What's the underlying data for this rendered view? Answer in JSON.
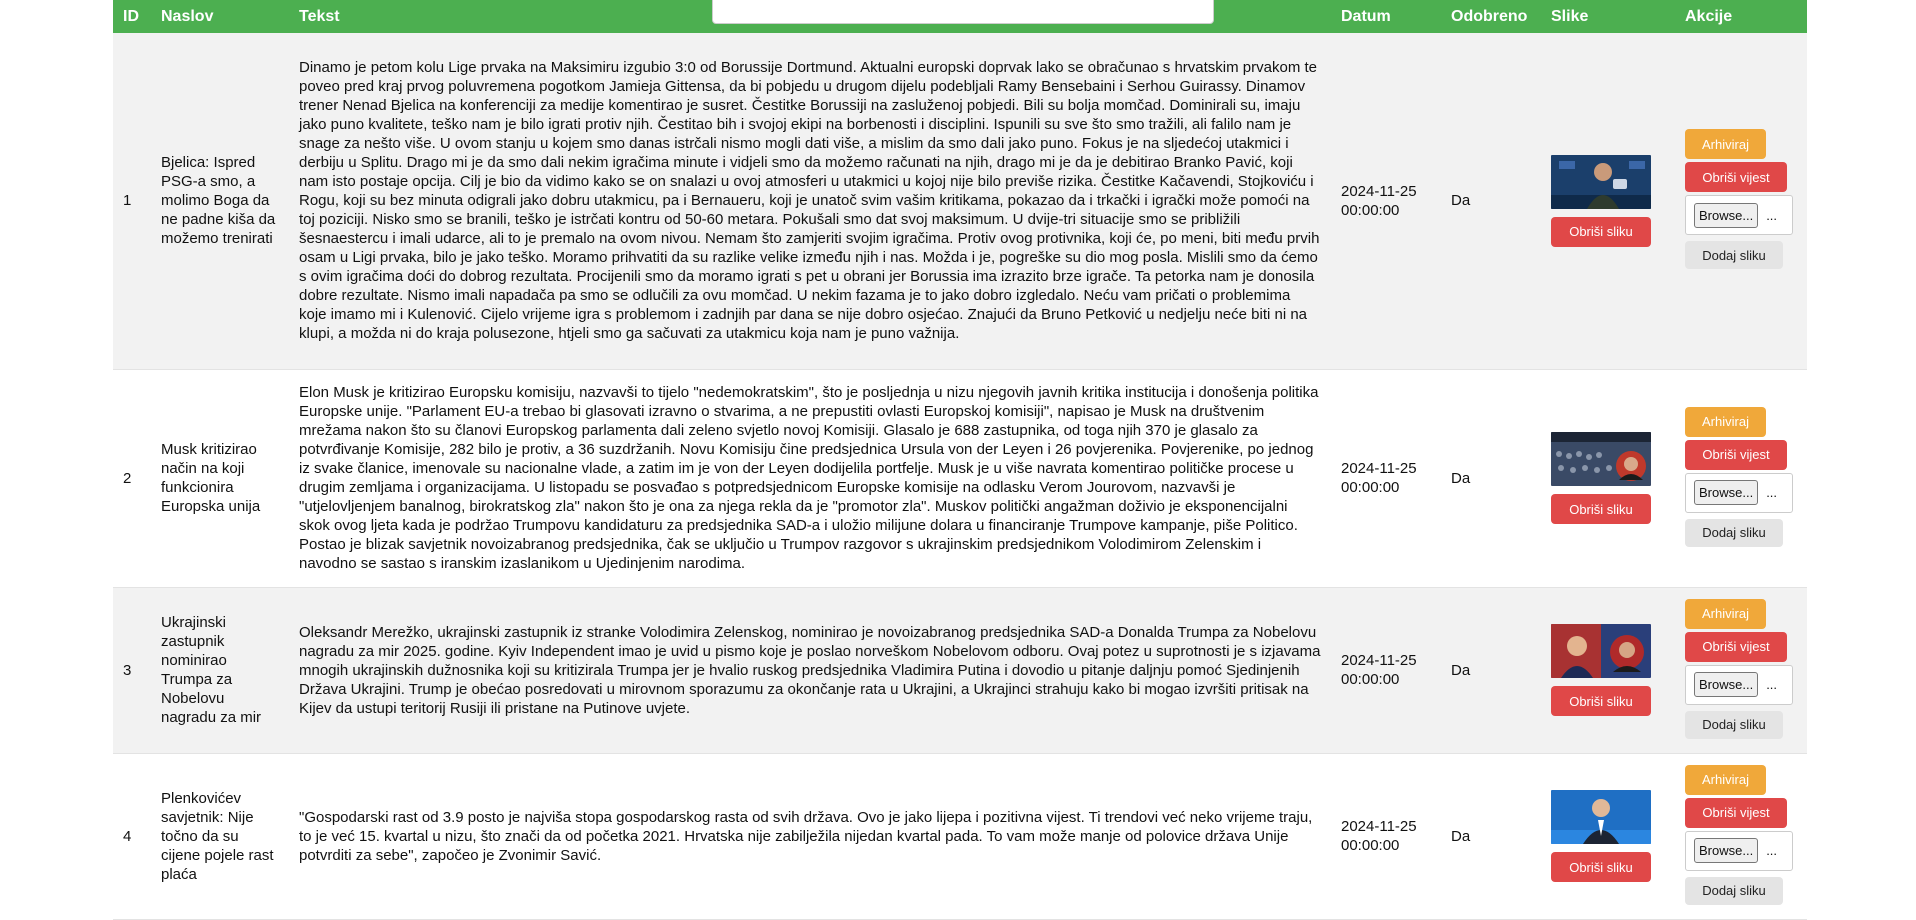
{
  "headers": {
    "id": "ID",
    "naslov": "Naslov",
    "tekst": "Tekst",
    "datum": "Datum",
    "odobreno": "Odobreno",
    "slike": "Slike",
    "akcije": "Akcije"
  },
  "labels": {
    "archive": "Arhiviraj",
    "delete_news": "Obriši vijest",
    "delete_image": "Obriši sliku",
    "browse": "Browse...",
    "file_none": "...",
    "add_image": "Dodaj sliku"
  },
  "rows": [
    {
      "id": "1",
      "naslov": "Bjelica: Ispred PSG-a smo, a molimo Boga da ne padne kiša da možemo trenirati",
      "tekst": "Dinamo je petom kolu Lige prvaka na Maksimiru izgubio 3:0 od Borussije Dortmund. Aktualni europski doprvak lako se obračunao s hrvatskim prvakom te poveo pred kraj prvog poluvremena pogotkom Jamieja Gittensa, da bi pobjedu u drugom dijelu podebljali Ramy Bensebaini i Serhou Guirassy. Dinamov trener Nenad Bjelica na konferenciji za medije komentirao je susret. Čestitke Borussiji na zasluženoj pobjedi. Bili su bolja momčad. Dominirali su, imaju jako puno kvalitete, teško nam je bilo igrati protiv njih. Čestitao bih i svojoj ekipi na borbenosti i disciplini. Ispunili su sve što smo tražili, ali falilo nam je snage za nešto više. U ovom stanju u kojem smo danas istrčali nismo mogli dati više, a mislim da smo dali jako puno. Fokus je na sljedećoj utakmici i derbiju u Splitu. Drago mi je da smo dali nekim igračima minute i vidjeli smo da možemo računati na njih, drago mi je da je debitirao Branko Pavić, koji nam isto postaje opcija. Cilj je bio da vidimo kako se on snalazi u ovoj atmosferi u utakmici u kojoj nije bilo previše rizika. Čestitke Kačavendi, Stojkoviću i Rogu, koji su bez minuta odigrali jako dobru utakmicu, pa i Bernaueru, koji je unatoč svim vašim kritikama, pokazao da i trkački i igrački može pomoći na toj poziciji. Nisko smo se branili, teško je istrčati kontru od 50-60 metara. Pokušali smo dat svoj maksimum. U dvije-tri situacije smo se približili šesnaestercu i imali udarce, ali to je premalo na ovom nivou. Nemam što zamjeriti svojim igračima. Protiv ovog protivnika, koji će, po meni, biti među prvih osam u Ligi prvaka, bilo je jako teško. Moramo prihvatiti da su razlike velike između njih i nas. Možda i je, pogreške su dio mog posla. Mislili smo da ćemo s ovim igračima doći do dobrog rezultata. Procijenili smo da moramo igrati s pet u obrani jer Borussia ima izrazito brze igrače. Ta petorka nam je donosila dobre rezultate. Nismo imali napadača pa smo se odlučili za ovu momčad. U nekim fazama je to jako dobro izgledalo. Neću vam pričati o problemima koje imamo mi i Kulenović. Cijelo vrijeme igra s problemom i zadnjih par dana se nije dobro osjećao. Znajući da Bruno Petković u nedjelju neće biti ni na klupi, a možda ni do kraja polusezone, htjeli smo ga sačuvati za utakmicu koja nam je puno važnija.",
      "datum": "2024-11-25 00:00:00",
      "odobreno": "Da"
    },
    {
      "id": "2",
      "naslov": "Musk kritizirao način na koji funkcionira Europska unija",
      "tekst": "Elon Musk je kritizirao Europsku komisiju, nazvavši to tijelo \"nedemokratskim\", što je posljednja u nizu njegovih javnih kritika institucija i donošenja politika Europske unije. \"Parlament EU-a trebao bi glasovati izravno o stvarima, a ne prepustiti ovlasti Europskoj komisiji\", napisao je Musk na društvenim mrežama nakon što su članovi Europskog parlamenta dali zeleno svjetlo novoj Komisiji. Glasalo je 688 zastupnika, od toga njih 370 je glasalo za potvrđivanje Komisije, 282 bilo je protiv, a 36 suzdržanih. Novu Komisiju čine predsjednica Ursula von der Leyen i 26 povjerenika. Povjerenike, po jednog iz svake članice, imenovale su nacionalne vlade, a zatim im je von der Leyen dodijelila portfelje. Musk je u više navrata komentirao političke procese u drugim zemljama i organizacijama. U listopadu se posvađao s potpredsjednicom Europske komisije na odlasku Verom Jourovom, nazvavši je \"utjelovljenjem banalnog, birokratskog zla\" nakon što je ona za njega rekla da je \"promotor zla\". Muskov politički angažman doživio je eksponencijalni skok ovog ljeta kada je podržao Trumpovu kandidaturu za predsjednika SAD-a i uložio milijune dolara u financiranje Trumpove kampanje, piše Politico. Postao je blizak savjetnik novoizabranog predsjednika, čak se uključio u Trumpov razgovor s ukrajinskim predsjednikom Volodimirom Zelenskim i navodno se sastao s iranskim izaslanikom u Ujedinjenim narodima.",
      "datum": "2024-11-25 00:00:00",
      "odobreno": "Da"
    },
    {
      "id": "3",
      "naslov": "Ukrajinski zastupnik nominirao Trumpa za Nobelovu nagradu za mir",
      "tekst": "Oleksandr Merežko, ukrajinski zastupnik iz stranke Volodimira Zelenskog, nominirao je novoizabranog predsjednika SAD-a Donalda Trumpa za Nobelovu nagradu za mir 2025. godine. Kyiv Independent imao je uvid u pismo koje je poslao norveškom Nobelovom odboru. Ovaj potez u suprotnosti je s izjavama mnogih ukrajinskih dužnosnika koji su kritizirala Trumpa jer je hvalio ruskog predsjednika Vladimira Putina i dovodio u pitanje daljnju pomoć Sjedinjenih Država Ukrajini. Trump je obećao posredovati u mirovnom sporazumu za okončanje rata u Ukrajini, a Ukrajinci strahuju kako bi mogao izvršiti pritisak na Kijev da ustupi teritorij Rusiji ili pristane na Putinove uvjete.",
      "datum": "2024-11-25 00:00:00",
      "odobreno": "Da"
    },
    {
      "id": "4",
      "naslov": "Plenkovićev savjetnik: Nije točno da su cijene pojele rast plaća",
      "tekst": "\"Gospodarski rast od 3.9 posto je najviša stopa gospodarskog rasta od svih država. Ovo je jako lijepa i pozitivna vijest. Ti trendovi već neko vrijeme traju, to je već 15. kvartal u nizu, što znači da od početka 2021. Hrvatska nije zabilježila nijedan kvartal pada. To vam može manje od polovice država Unije potvrditi za sebe\", započeo je Zvonimir Savić.",
      "datum": "2024-11-25 00:00:00",
      "odobreno": "Da"
    }
  ]
}
